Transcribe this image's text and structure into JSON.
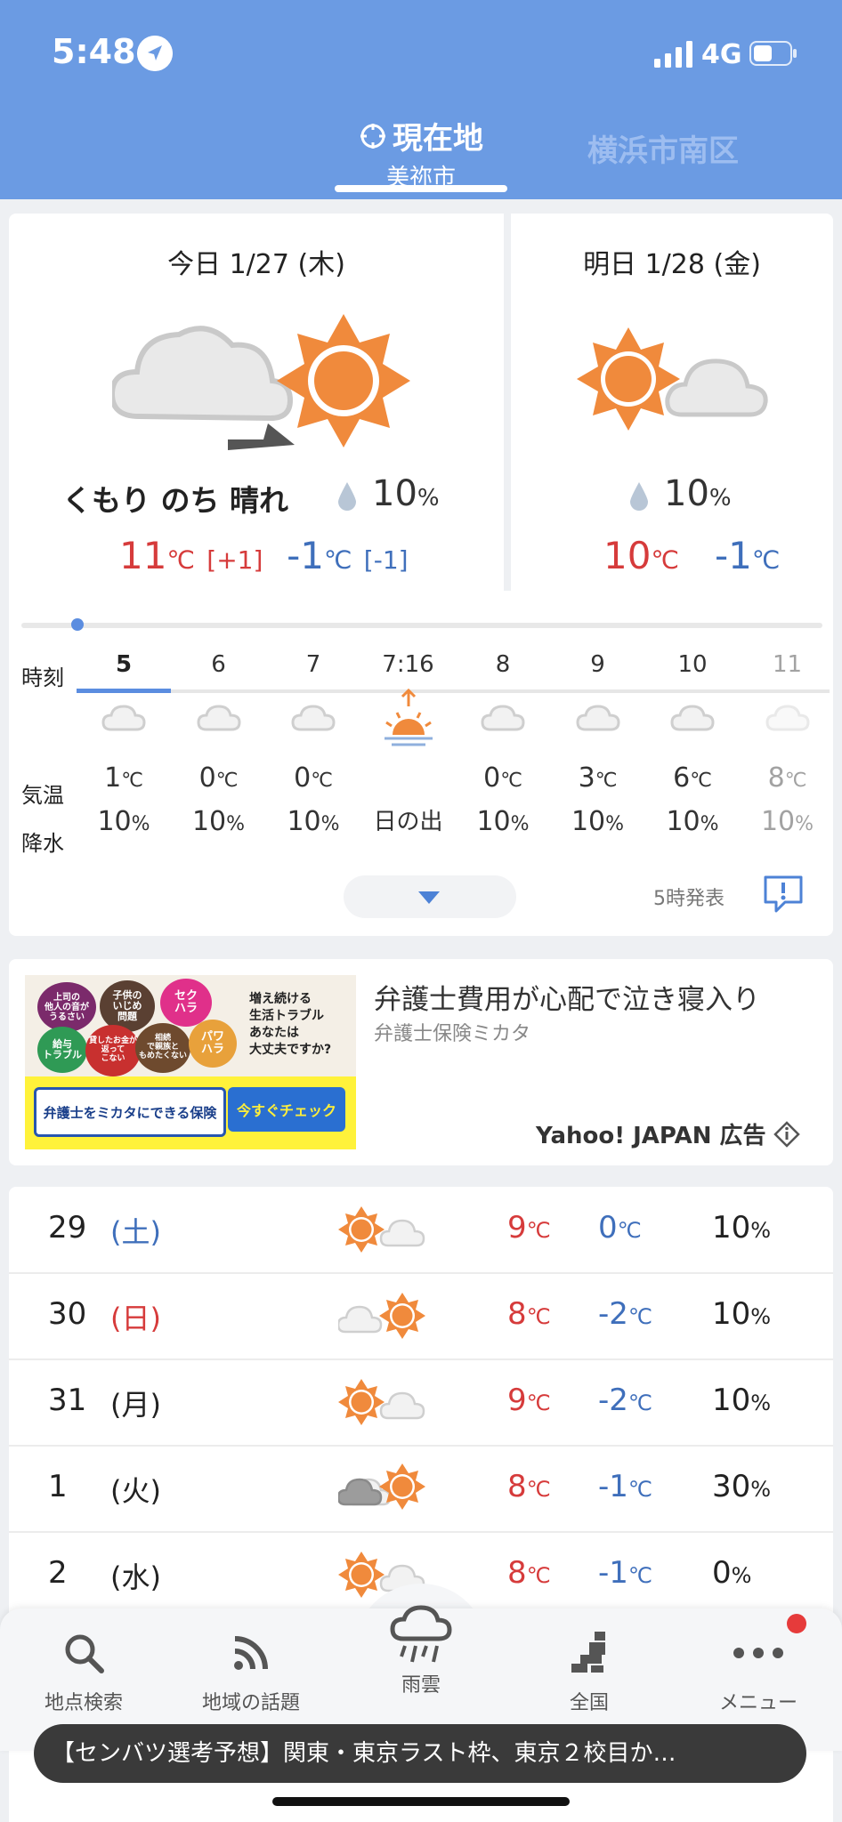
{
  "status": {
    "time": "5:48",
    "network": "4G"
  },
  "tabs": {
    "current_label": "現在地",
    "current_sub": "美祢市",
    "other_label": "横浜市南区"
  },
  "today": {
    "label": "今日 1/27 (木)",
    "condition": "くもり のち 晴れ",
    "rain": "10",
    "rain_unit": "%",
    "high": "11",
    "high_unit": "℃",
    "high_diff": "[+1]",
    "low": "-1",
    "low_unit": "℃",
    "low_diff": "[-1]",
    "icon": "cloud-then-sun"
  },
  "tomorrow": {
    "label": "明日 1/28 (金)",
    "rain": "10",
    "rain_unit": "%",
    "high": "10",
    "high_unit": "℃",
    "low": "-1",
    "low_unit": "℃",
    "icon": "sun-and-cloud"
  },
  "hourly": {
    "row_labels": {
      "time": "時刻",
      "temp": "気温",
      "rain": "降水"
    },
    "hours": [
      {
        "hour": "5",
        "temp": "1",
        "unit": "℃",
        "rain": "10",
        "icon": "cloud-icon"
      },
      {
        "hour": "6",
        "temp": "0",
        "unit": "℃",
        "rain": "10",
        "icon": "cloud-icon"
      },
      {
        "hour": "7",
        "temp": "0",
        "unit": "℃",
        "rain": "10",
        "icon": "cloud-icon"
      },
      {
        "hour": "7:16",
        "label": "日の出",
        "icon": "sunrise-icon"
      },
      {
        "hour": "8",
        "temp": "0",
        "unit": "℃",
        "rain": "10",
        "icon": "cloud-icon"
      },
      {
        "hour": "9",
        "temp": "3",
        "unit": "℃",
        "rain": "10",
        "icon": "cloud-icon"
      },
      {
        "hour": "10",
        "temp": "6",
        "unit": "℃",
        "rain": "10",
        "icon": "cloud-icon"
      },
      {
        "hour": "11",
        "temp": "8",
        "unit": "℃",
        "rain": "10",
        "icon": "cloud-icon"
      }
    ],
    "rain_unit": "%",
    "issued": "5時発表"
  },
  "ad": {
    "title": "弁護士費用が心配で泣き寝入り",
    "advertiser": "弁護士保険ミカタ",
    "label": "Yahoo! JAPAN 広告",
    "bubbles": [
      "上司の\n他人の音が\nうるさい",
      "子供の\nいじめ\n問題",
      "セク\nハラ",
      "給与\nトラブル",
      "貸したお金が\n返って\nこない",
      "相続\nで親族と\nもめたくない",
      "パワ\nハラ"
    ],
    "copy": "増え続ける\n生活トラブル\nあなたは\n大丈夫ですか?",
    "button1": "弁護士をミカタにできる保険",
    "button2": "今すぐチェック"
  },
  "weekly": [
    {
      "date": "29",
      "dow": "(土)",
      "type": "sat",
      "icon": "sun-cloud",
      "high": "9",
      "low": "0",
      "rain": "10"
    },
    {
      "date": "30",
      "dow": "(日)",
      "type": "sun",
      "icon": "cloud-sun",
      "high": "8",
      "low": "-2",
      "rain": "10"
    },
    {
      "date": "31",
      "dow": "(月)",
      "type": "",
      "icon": "sun-cloud",
      "high": "9",
      "low": "-2",
      "rain": "10"
    },
    {
      "date": "1",
      "dow": "(火)",
      "type": "",
      "icon": "clouds-sun",
      "high": "8",
      "low": "-1",
      "rain": "30"
    },
    {
      "date": "2",
      "dow": "(水)",
      "type": "",
      "icon": "sun-cloud",
      "high": "8",
      "low": "-1",
      "rain": "0"
    }
  ],
  "weekly_units": {
    "temp": "℃",
    "rain": "%"
  },
  "nav": {
    "items": [
      {
        "label": "地点検索",
        "icon": "search-icon"
      },
      {
        "label": "地域の話題",
        "icon": "rss-icon"
      },
      {
        "label": "雨雲",
        "icon": "rain-cloud-icon"
      },
      {
        "label": "全国",
        "icon": "japan-map-icon"
      },
      {
        "label": "メニュー",
        "icon": "more-icon"
      }
    ]
  },
  "news": "【センバツ選考予想】関東・東京ラスト枠、東京２校目か…",
  "colors": {
    "header": "#6b9be3",
    "accent": "#5b8de0",
    "high": "#d63b3b",
    "low": "#3f6fbb",
    "sun": "#f08a3c"
  }
}
